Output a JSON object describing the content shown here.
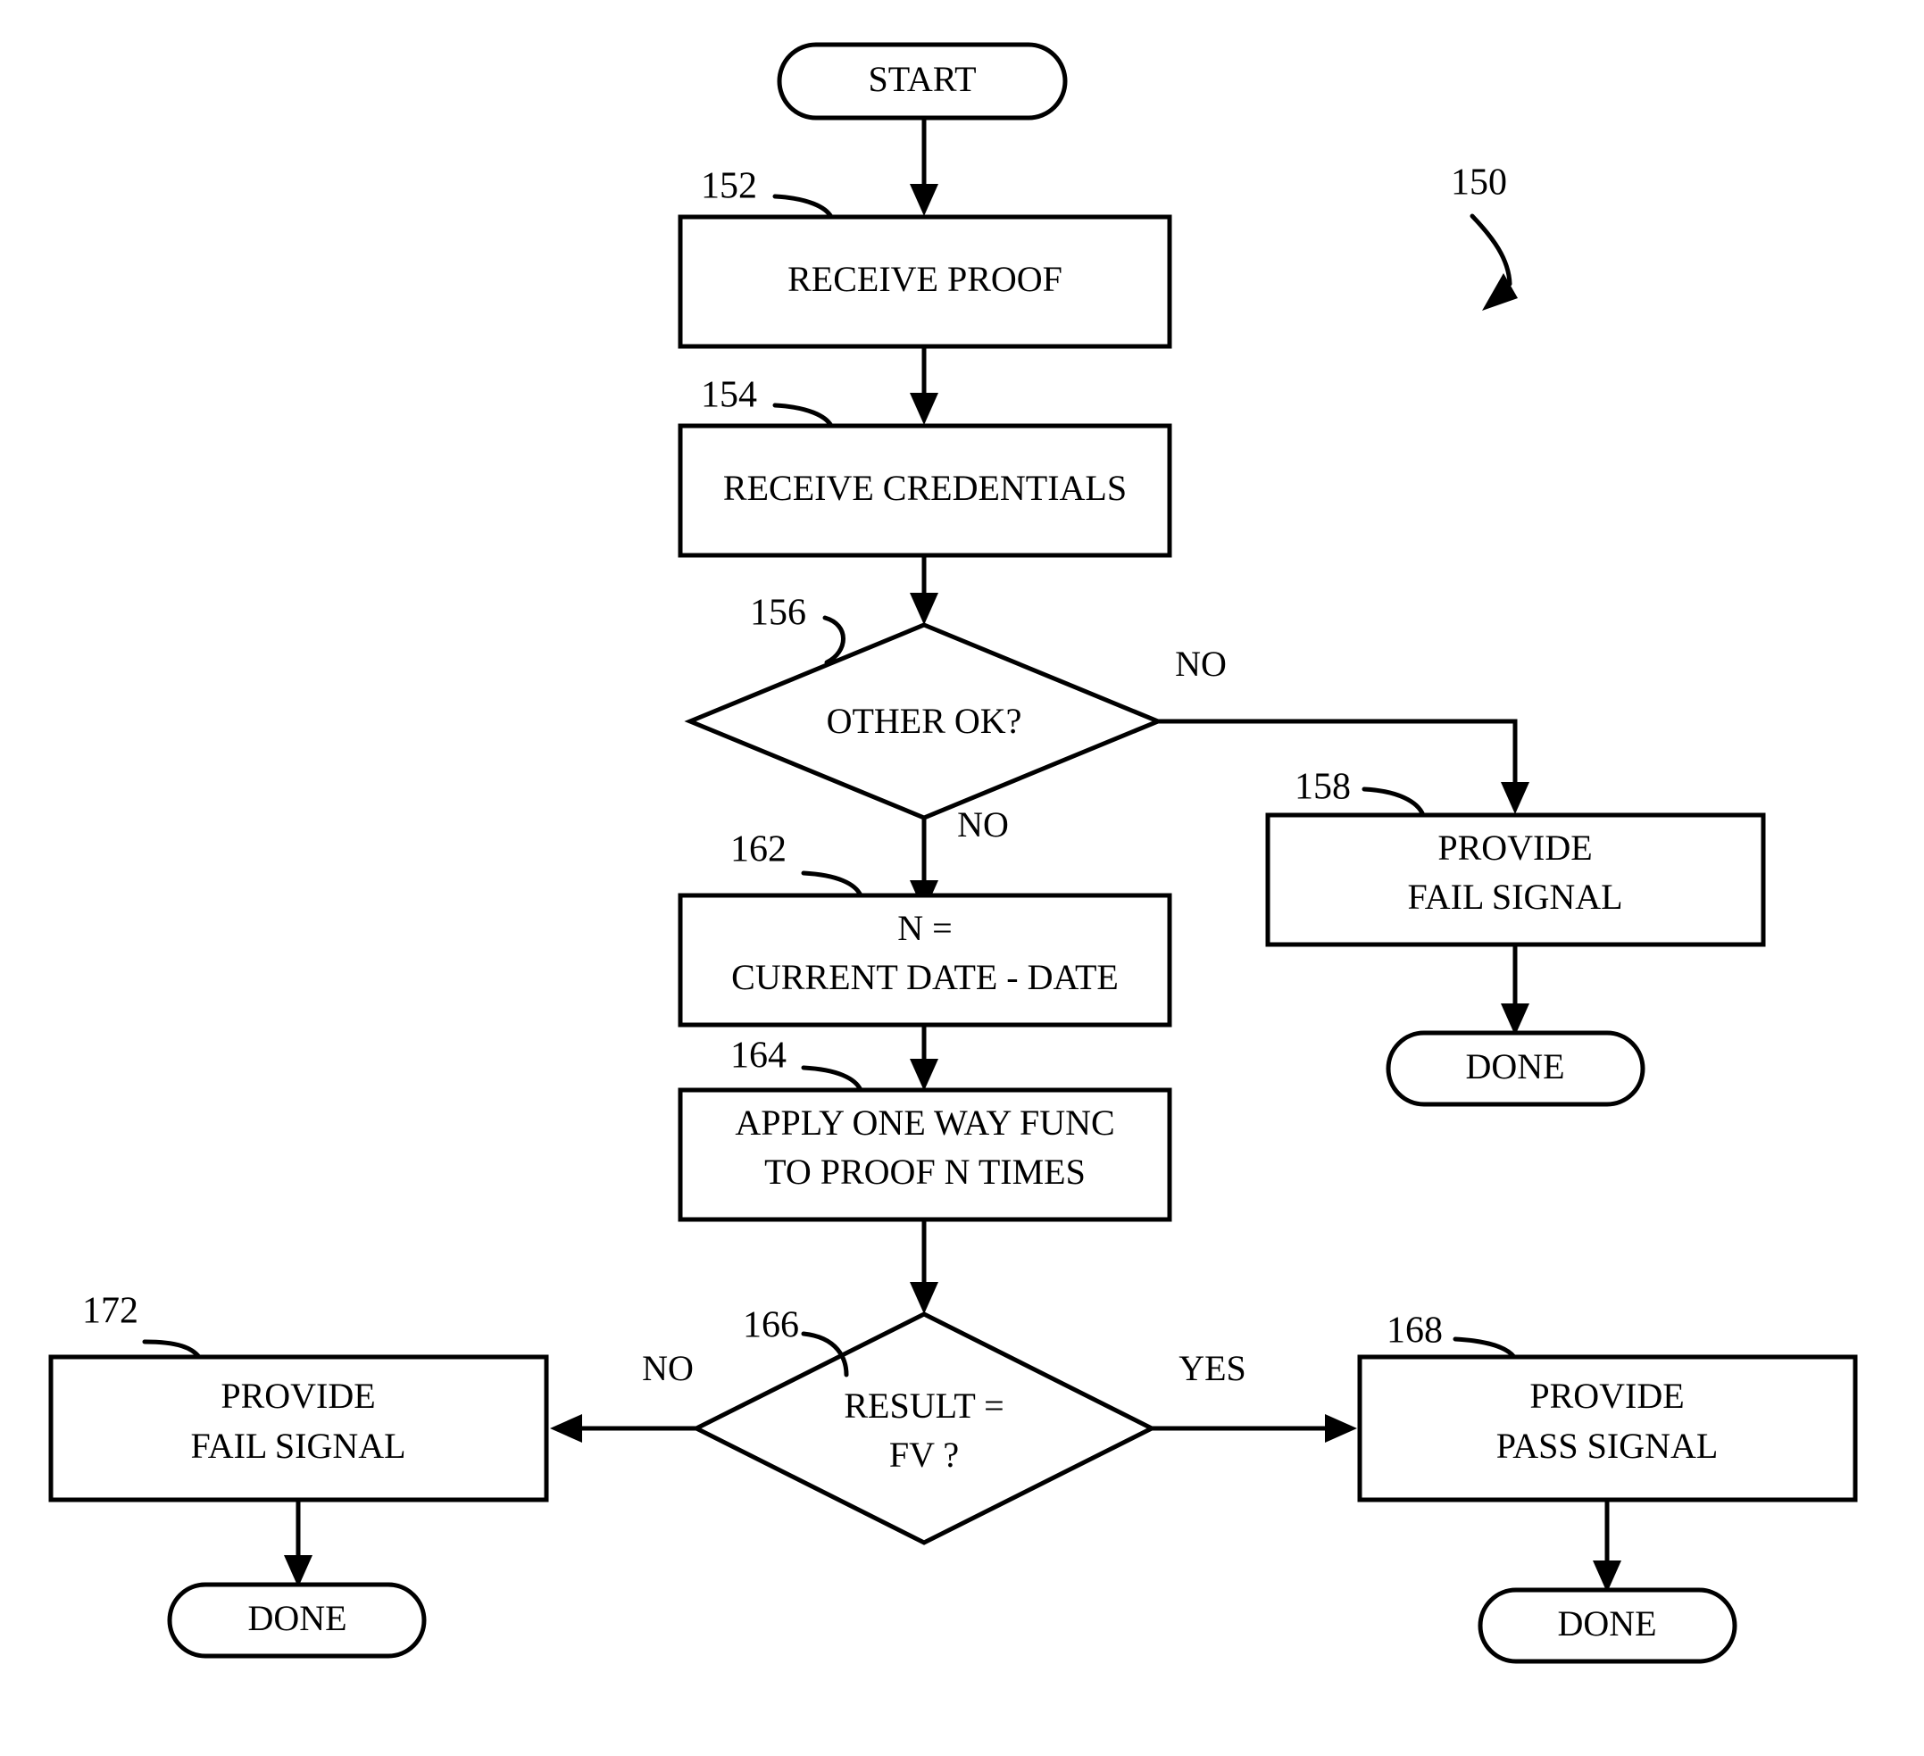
{
  "figure": {
    "reference_numeral": "150",
    "nodes": {
      "start": {
        "ref": "",
        "label": "START",
        "shape": "terminator"
      },
      "receive_proof": {
        "ref": "152",
        "label": "RECEIVE  PROOF",
        "shape": "process"
      },
      "receive_credentials": {
        "ref": "154",
        "label": "RECEIVE CREDENTIALS",
        "shape": "process"
      },
      "other_ok": {
        "ref": "156",
        "label": "OTHER OK?",
        "shape": "decision"
      },
      "provide_fail_signal_158": {
        "ref": "158",
        "line1": "PROVIDE",
        "line2": "FAIL SIGNAL",
        "shape": "process"
      },
      "done_158": {
        "label": "DONE",
        "shape": "terminator"
      },
      "compute_n": {
        "ref": "162",
        "line1": "N =",
        "line2": "CURRENT DATE - DATE",
        "shape": "process"
      },
      "apply_owf": {
        "ref": "164",
        "line1": "APPLY ONE WAY FUNC",
        "line2": "TO PROOF N TIMES",
        "shape": "process"
      },
      "result_fv": {
        "ref": "166",
        "line1": "RESULT =",
        "line2": "FV ?",
        "shape": "decision"
      },
      "provide_fail_signal_172": {
        "ref": "172",
        "line1": "PROVIDE",
        "line2": "FAIL SIGNAL",
        "shape": "process"
      },
      "done_172": {
        "label": "DONE",
        "shape": "terminator"
      },
      "provide_pass_signal_168": {
        "ref": "168",
        "line1": "PROVIDE",
        "line2": "PASS SIGNAL",
        "shape": "process"
      },
      "done_168": {
        "label": "DONE",
        "shape": "terminator"
      }
    },
    "edge_labels": {
      "other_ok_no_right": "NO",
      "other_ok_no_down": "NO",
      "result_fv_no": "NO",
      "result_fv_yes": "YES"
    },
    "colors": {
      "stroke": "#000000",
      "fill": "#ffffff",
      "background": "#ffffff"
    }
  }
}
